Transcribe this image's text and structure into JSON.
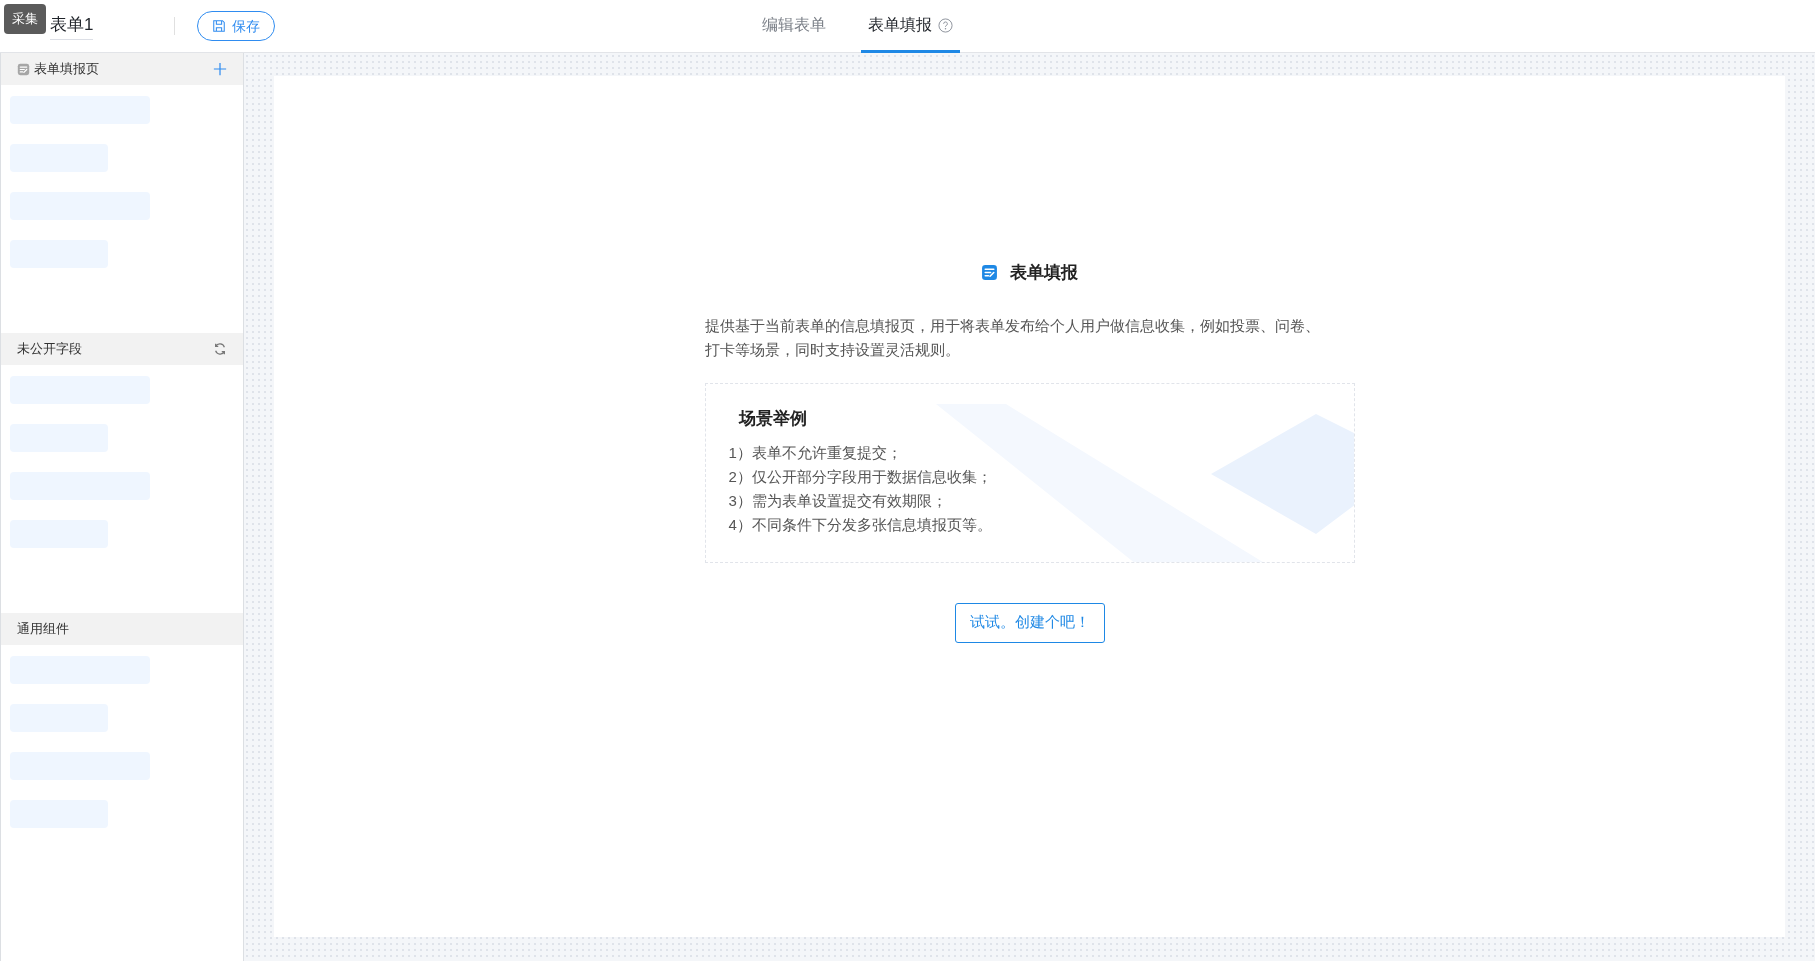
{
  "header": {
    "badge": "采集",
    "title": "表单1",
    "save_button": "保存",
    "tabs": [
      {
        "label": "编辑表单",
        "selected": false,
        "help": false
      },
      {
        "label": "表单填报",
        "selected": true,
        "help": true
      }
    ]
  },
  "sidebar": {
    "sections": [
      {
        "kind": "add",
        "label": "表单填报页",
        "icon": true
      },
      {
        "kind": "refresh",
        "label": "未公开字段",
        "icon": false
      },
      {
        "kind": "plain",
        "label": "通用组件",
        "icon": false
      }
    ]
  },
  "intro": {
    "title": "表单填报",
    "description": "提供基于当前表单的信息填报页，用于将表单发布给个人用户做信息收集，例如投票、问卷、打卡等场景，同时支持设置灵活规则。",
    "examples_title": "场景举例",
    "examples": [
      "1）表单不允许重复提交；",
      "2）仅公开部分字段用于数据信息收集；",
      "3）需为表单设置提交有效期限；",
      "4）不同条件下分发多张信息填报页等。"
    ],
    "button": "试试。创建个吧！"
  }
}
